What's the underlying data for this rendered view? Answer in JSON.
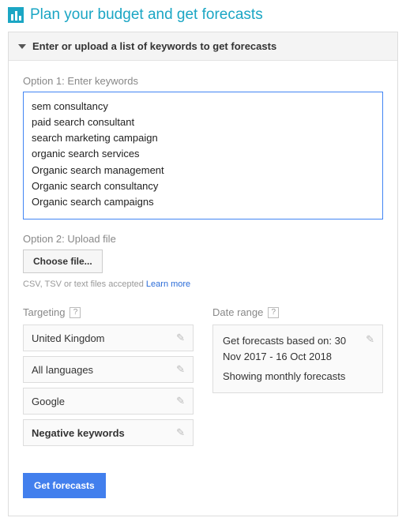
{
  "title": "Plan your budget and get forecasts",
  "panel": {
    "header": "Enter or upload a list of keywords to get forecasts"
  },
  "option1": {
    "label": "Option 1: Enter keywords",
    "keywords": "sem consultancy\npaid search consultant\nsearch marketing campaign\norganic search services\nOrganic search management\nOrganic search consultancy\nOrganic search campaigns\n"
  },
  "option2": {
    "label": "Option 2: Upload file",
    "choose_file": "Choose file...",
    "helper": "CSV, TSV or text files accepted ",
    "learn_more": "Learn more"
  },
  "targeting": {
    "label": "Targeting",
    "help": "?",
    "rows": [
      {
        "text": "United Kingdom"
      },
      {
        "text": "All languages"
      },
      {
        "text": "Google"
      },
      {
        "text": "Negative keywords",
        "bold": true
      }
    ]
  },
  "daterange": {
    "label": "Date range",
    "help": "?",
    "line1": "Get forecasts based on: 30 Nov 2017 - 16 Oct 2018",
    "line2": "Showing monthly forecasts"
  },
  "submit": "Get forecasts"
}
